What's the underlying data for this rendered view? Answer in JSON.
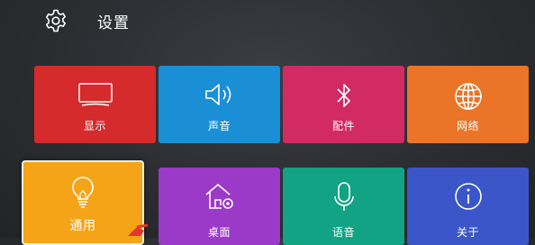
{
  "header": {
    "title": "设置",
    "icon": "gear-icon"
  },
  "tiles": [
    {
      "label": "显示",
      "icon": "tv-icon",
      "color": "#d62b2c"
    },
    {
      "label": "声音",
      "icon": "speaker-icon",
      "color": "#1a8fd6"
    },
    {
      "label": "配件",
      "icon": "bluetooth-icon",
      "color": "#d22b64"
    },
    {
      "label": "网络",
      "icon": "globe-icon",
      "color": "#ea7427"
    },
    {
      "label": "通用",
      "icon": "lightbulb-icon",
      "color": "#f5a417",
      "selected": true
    },
    {
      "label": "桌面",
      "icon": "home-settings-icon",
      "color": "#9b39c8"
    },
    {
      "label": "语音",
      "icon": "microphone-icon",
      "color": "#11a383"
    },
    {
      "label": "关于",
      "icon": "info-icon",
      "color": "#3b56c8"
    }
  ]
}
